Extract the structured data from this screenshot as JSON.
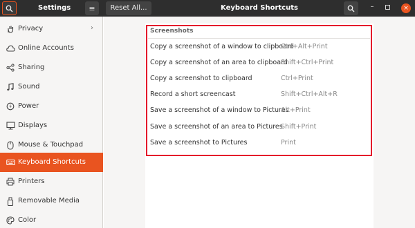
{
  "titlebar": {
    "app_title": "Settings",
    "reset_label": "Reset All...",
    "window_title": "Keyboard Shortcuts",
    "menu_glyph": "≡",
    "close_glyph": "×",
    "minimize_glyph": "–"
  },
  "sidebar": {
    "items": [
      {
        "label": "Privacy",
        "icon": "hand-icon"
      },
      {
        "label": "Online Accounts",
        "icon": "cloud-icon"
      },
      {
        "label": "Sharing",
        "icon": "share-icon"
      },
      {
        "label": "Sound",
        "icon": "music-note-icon"
      },
      {
        "label": "Power",
        "icon": "power-icon"
      },
      {
        "label": "Displays",
        "icon": "monitor-icon"
      },
      {
        "label": "Mouse & Touchpad",
        "icon": "mouse-icon"
      },
      {
        "label": "Keyboard Shortcuts",
        "icon": "keyboard-icon",
        "active": true
      },
      {
        "label": "Printers",
        "icon": "printer-icon"
      },
      {
        "label": "Removable Media",
        "icon": "usb-icon"
      },
      {
        "label": "Color",
        "icon": "palette-icon"
      }
    ]
  },
  "main": {
    "section_title": "Screenshots",
    "shortcuts": [
      {
        "action": "Copy a screenshot of a window to clipboard",
        "keys": "Ctrl+Alt+Print"
      },
      {
        "action": "Copy a screenshot of an area to clipboard",
        "keys": "Shift+Ctrl+Print"
      },
      {
        "action": "Copy a screenshot to clipboard",
        "keys": "Ctrl+Print"
      },
      {
        "action": "Record a short screencast",
        "keys": "Shift+Ctrl+Alt+R"
      },
      {
        "action": "Save a screenshot of a window to Pictures",
        "keys": "Alt+Print"
      },
      {
        "action": "Save a screenshot of an area to Pictures",
        "keys": "Shift+Print"
      },
      {
        "action": "Save a screenshot to Pictures",
        "keys": "Print"
      }
    ]
  },
  "colors": {
    "accent": "#e95420",
    "titlebar": "#2e2e2e",
    "highlight": "#e4142b"
  }
}
